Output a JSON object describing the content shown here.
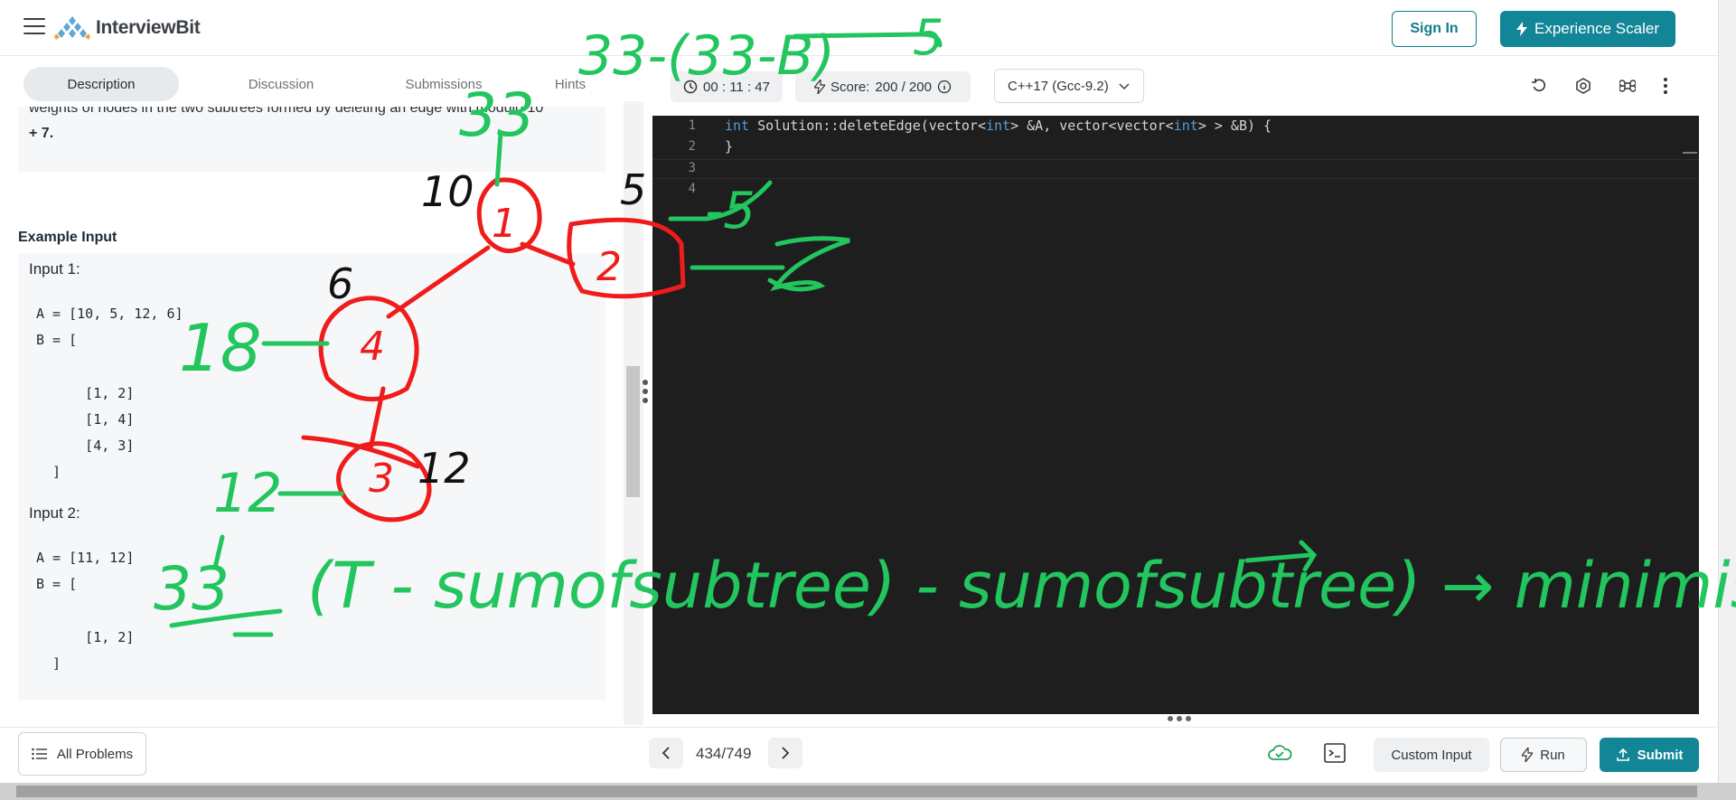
{
  "header": {
    "brand": "InterviewBit",
    "sign_in_label": "Sign In",
    "cta_label": "Experience Scaler"
  },
  "tabs": [
    {
      "label": "Description",
      "active": true
    },
    {
      "label": "Discussion",
      "active": false
    },
    {
      "label": "Submissions",
      "active": false
    },
    {
      "label": "Hints",
      "active": false
    }
  ],
  "problem": {
    "desc_line_1": "weights of nodes in the two subtrees formed by deleting an edge with modulo 10",
    "desc_line_2": "+ 7.",
    "example_title": "Example Input",
    "input1_label": "Input 1:",
    "input1_lines": [
      "A = [10, 5, 12, 6]",
      "B = [",
      "",
      "      [1, 2]",
      "      [1, 4]",
      "      [4, 3]",
      "  ]"
    ],
    "input2_label": "Input 2:",
    "input2_lines": [
      "A = [11, 12]",
      "B = [",
      "",
      "      [1, 2]",
      "  ]"
    ]
  },
  "toolbar": {
    "timer": "00 : 11 : 47",
    "score_label": "Score:",
    "score_value": "200  /  200",
    "language": "C++17 (Gcc-9.2)"
  },
  "editor": {
    "line_numbers": [
      "1",
      "2",
      "3",
      "4"
    ],
    "code_line_1_a": "int",
    "code_line_1_b": " Solution::deleteEdge(vector<",
    "code_line_1_c": "int",
    "code_line_1_d": "> &A, vector<vector<",
    "code_line_1_e": "int",
    "code_line_1_f": "> > &B) {",
    "code_line_2": "}"
  },
  "footer": {
    "all_problems_label": "All Problems",
    "counter": "434/749",
    "custom_input_label": "Custom Input",
    "run_label": "Run",
    "submit_label": "Submit"
  },
  "annotation": {
    "ink_color": "#22c55e",
    "tree_color": "#ef1c1c",
    "num_10": "10",
    "num_5": "5",
    "num_6": "6",
    "num_12": "12",
    "node_1": "1",
    "node_2": "2",
    "node_4": "4",
    "node_3": "3",
    "note_top": "33-(33-B)",
    "note_5": "5",
    "note_18": "18",
    "note_12": "12",
    "note_33": "33",
    "note_minus5": "-5",
    "formula": "(T - sumofsubtree) - sumofsubtree) → minimise"
  }
}
